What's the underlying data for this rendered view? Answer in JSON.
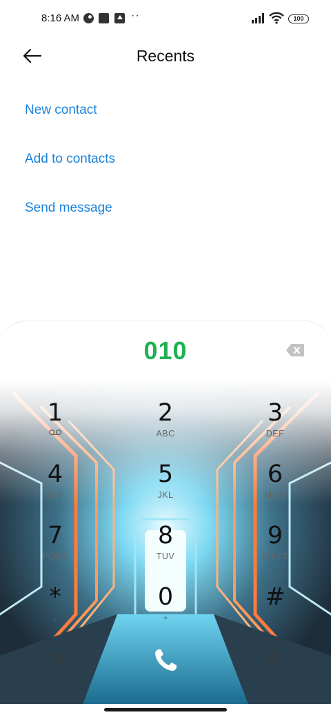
{
  "status_bar": {
    "time": "8:16 AM",
    "dots": "··",
    "battery": "100",
    "icons": [
      "notification-circle-icon",
      "square-app-icon",
      "upload-icon",
      "signal-icon",
      "wifi-icon",
      "battery-icon"
    ]
  },
  "header": {
    "title": "Recents",
    "back_icon": "back-arrow-icon"
  },
  "actions": [
    {
      "label": "New contact"
    },
    {
      "label": "Add to contacts"
    },
    {
      "label": "Send message"
    }
  ],
  "dialer": {
    "number": "010",
    "number_color": "#1fb152",
    "backspace_icon": "backspace-icon",
    "keys": [
      {
        "digit": "1",
        "sub": "voicemail-icon"
      },
      {
        "digit": "2",
        "sub": "ABC"
      },
      {
        "digit": "3",
        "sub": "DEF"
      },
      {
        "digit": "4",
        "sub": "GHI"
      },
      {
        "digit": "5",
        "sub": "JKL"
      },
      {
        "digit": "6",
        "sub": "MNO"
      },
      {
        "digit": "7",
        "sub": "PQRS"
      },
      {
        "digit": "8",
        "sub": "TUV"
      },
      {
        "digit": "9",
        "sub": "WXYZ"
      },
      {
        "digit": "*",
        "sub": ","
      },
      {
        "digit": "0",
        "sub": "+"
      },
      {
        "digit": "#",
        "sub": ""
      }
    ],
    "bottom": {
      "menu_icon": "menu-icon",
      "call_icon": "phone-icon",
      "keypad_icon": "keypad-icon"
    }
  },
  "colors": {
    "accent": "#1a82dc",
    "number": "#1fb152"
  }
}
